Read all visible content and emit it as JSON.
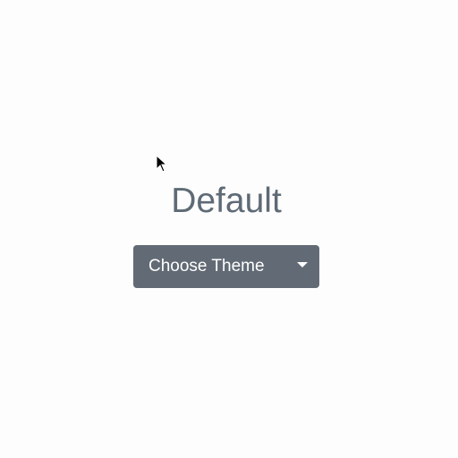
{
  "theme_title": "Default",
  "dropdown": {
    "label": "Choose Theme"
  },
  "icons": {
    "cursor": "mouse-pointer-icon",
    "caret": "caret-down-icon"
  },
  "colors": {
    "background": "#fdfdfd",
    "title_text": "#5e6a75",
    "button_bg": "#626b75",
    "button_text": "#ffffff"
  }
}
